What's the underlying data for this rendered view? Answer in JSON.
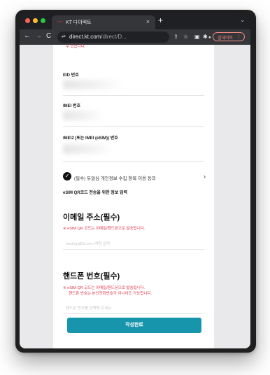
{
  "browser": {
    "tab_title": "KT 다이렉트",
    "tab_close": "×",
    "new_tab": "+",
    "tab_menu": "⌄",
    "nav": {
      "back": "←",
      "forward": "→",
      "reload": "C"
    },
    "url_domain": "direct.kt.com",
    "url_path": "/direct/D...",
    "update_label": "업데이트",
    "update_more": "⋮"
  },
  "form": {
    "clipped_note": "수 있습니다.",
    "eid_label": "EID 번호",
    "imei_label": "IMEI 번호",
    "imei2_label": "IMEI2 (또는 IMEI (eSIM)) 번호",
    "agreement": {
      "text": "(필수) 듀얼심 개인정보 수집 항목 이용 동의",
      "check_glyph": "✓",
      "chevron": "›"
    },
    "esim_info_heading": "eSIM QR코드 전송을 위한 정보 입력",
    "email": {
      "title": "이메일 주소(필수)",
      "notice": "※ eSIM QR 코드는 이메일/핸드폰으로 발송됩니다.",
      "placeholder": "Imshop@kt.com 처럼 입력"
    },
    "phone": {
      "title": "핸드폰 번호(필수)",
      "notice_line1": "※ eSIM QR 코드는 이메일/핸드폰으로 발송됩니다.",
      "notice_line2": "핸드폰 번호는 본인전화번호가 아니어도 가능합니다.",
      "placeholder": "핸드폰 번호를 입력해 주세요"
    },
    "submit_label": "작성완료"
  },
  "colors": {
    "accent_button": "#1795ad",
    "notice_red": "#e0364b",
    "browser_chrome": "#35363a"
  }
}
